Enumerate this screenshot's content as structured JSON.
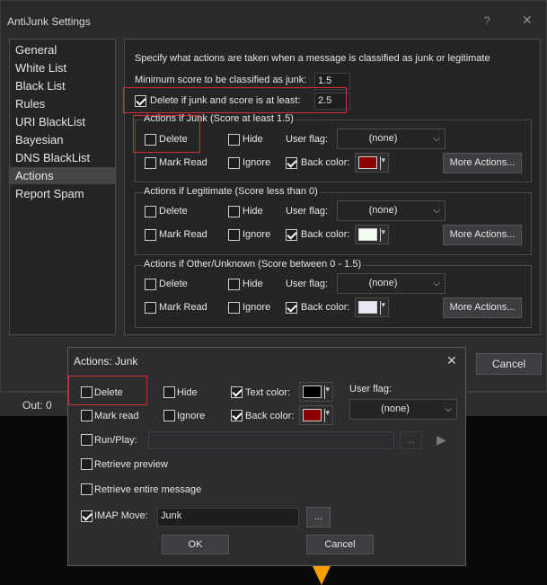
{
  "window": {
    "title": "AntiJunk Settings",
    "help_label": "?",
    "close_label": "✕"
  },
  "sidebar": {
    "items": [
      {
        "label": "General"
      },
      {
        "label": "White List"
      },
      {
        "label": "Black List"
      },
      {
        "label": "Rules"
      },
      {
        "label": "URI BlackList"
      },
      {
        "label": "Bayesian"
      },
      {
        "label": "DNS BlackList"
      },
      {
        "label": "Actions",
        "selected": true
      },
      {
        "label": "Report Spam"
      }
    ]
  },
  "actions": {
    "description": "Specify what actions are taken when a message is classified as junk or legitimate",
    "min_score_label": "Minimum score to be classified as junk:",
    "min_score_value": "1.5",
    "delete_if_label": "Delete if junk and score is at least:",
    "delete_if_checked": true,
    "delete_if_value": "2.5",
    "groups": [
      {
        "title": "Actions if Junk  (Score at least 1.5)",
        "delete": "Delete",
        "hide": "Hide",
        "user_flag": "User flag:",
        "flag_value": "(none)",
        "mark_read": "Mark Read",
        "ignore": "Ignore",
        "back_color": "Back color:",
        "back_color_checked": true,
        "color": "#8b0000",
        "more": "More Actions..."
      },
      {
        "title": "Actions if Legitimate  (Score less than 0)",
        "delete": "Delete",
        "hide": "Hide",
        "user_flag": "User flag:",
        "flag_value": "(none)",
        "mark_read": "Mark Read",
        "ignore": "Ignore",
        "back_color": "Back color:",
        "back_color_checked": true,
        "color": "#f0fff0",
        "more": "More Actions..."
      },
      {
        "title": "Actions if Other/Unknown  (Score between 0 - 1.5)",
        "delete": "Delete",
        "hide": "Hide",
        "user_flag": "User flag:",
        "flag_value": "(none)",
        "mark_read": "Mark Read",
        "ignore": "Ignore",
        "back_color": "Back color:",
        "back_color_checked": true,
        "color": "#e8e8f8",
        "more": "More Actions..."
      }
    ]
  },
  "main_cancel_label": "Cancel",
  "status": {
    "out": "Out: 0"
  },
  "dialog": {
    "title": "Actions: Junk",
    "close_label": "✕",
    "delete": "Delete",
    "hide": "Hide",
    "text_color": "Text color:",
    "text_color_checked": true,
    "text_color_value": "#000000",
    "mark_read": "Mark read",
    "ignore": "Ignore",
    "back_color": "Back color:",
    "back_color_checked": true,
    "back_color_value": "#8b0000",
    "user_flag": "User flag:",
    "user_flag_value": "(none)",
    "run_play": "Run/Play:",
    "run_play_value": "",
    "browse_label": "...",
    "retrieve_preview": "Retrieve preview",
    "retrieve_entire": "Retrieve entire message",
    "imap_move": "IMAP Move:",
    "imap_move_checked": true,
    "imap_move_value": "Junk",
    "imap_browse_label": "...",
    "ok_label": "OK",
    "cancel_label": "Cancel"
  },
  "colors": {
    "accent_red_box": "#d32f2f",
    "selection": "#454548"
  }
}
